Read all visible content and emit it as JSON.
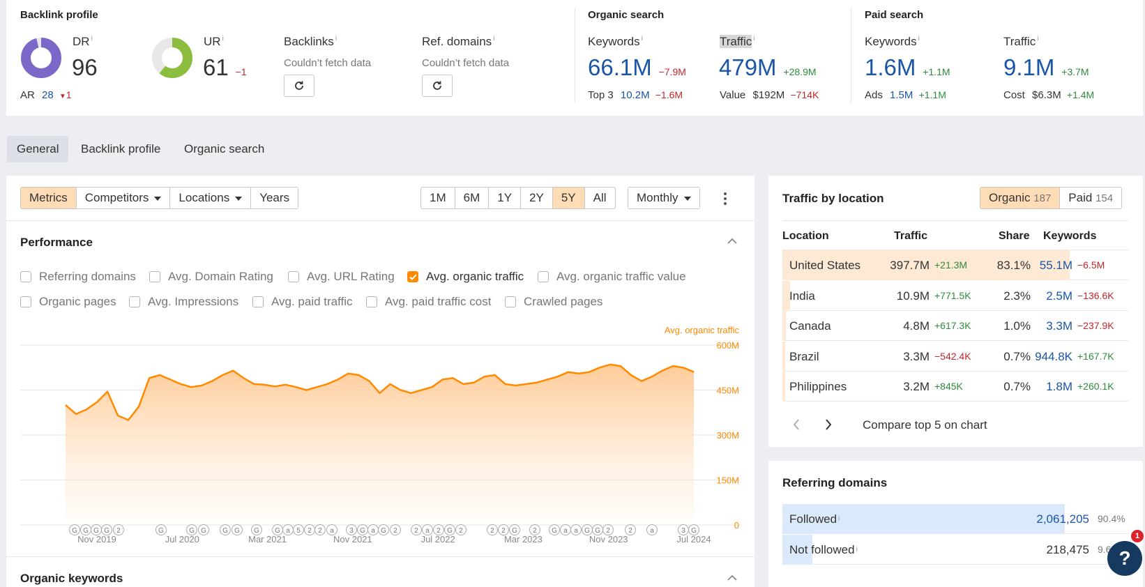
{
  "top": {
    "backlink": {
      "title": "Backlink profile",
      "dr_label": "DR",
      "dr_value": "96",
      "dr_fraction": 0.96,
      "ar_label": "AR",
      "ar_value": "28",
      "ar_delta": "1",
      "ur_label": "UR",
      "ur_value": "61",
      "ur_delta": "−1",
      "ur_fraction": 0.61,
      "backlinks_label": "Backlinks",
      "backlinks_status": "Couldn’t fetch data",
      "refdomains_label": "Ref. domains",
      "refdomains_status": "Couldn’t fetch data"
    },
    "organic": {
      "title": "Organic search",
      "keywords_label": "Keywords",
      "keywords_value": "66.1M",
      "keywords_delta": "−7.9M",
      "top3_label": "Top 3",
      "top3_value": "10.2M",
      "top3_delta": "−1.6M",
      "traffic_label": "Traffic",
      "traffic_value": "479M",
      "traffic_delta": "+28.9M",
      "value_label": "Value",
      "value_value": "$192M",
      "value_delta": "−714K"
    },
    "paid": {
      "title": "Paid search",
      "keywords_label": "Keywords",
      "keywords_value": "1.6M",
      "keywords_delta": "+1.1M",
      "ads_label": "Ads",
      "ads_value": "1.5M",
      "ads_delta": "+1.1M",
      "traffic_label": "Traffic",
      "traffic_value": "9.1M",
      "traffic_delta": "+3.7M",
      "cost_label": "Cost",
      "cost_value": "$6.3M",
      "cost_delta": "+1.4M"
    }
  },
  "tabs": [
    "General",
    "Backlink profile",
    "Organic search"
  ],
  "toolbar": {
    "modes": [
      "Metrics",
      "Competitors",
      "Locations",
      "Years"
    ],
    "ranges": [
      "1M",
      "6M",
      "1Y",
      "2Y",
      "5Y",
      "All"
    ],
    "interval": "Monthly"
  },
  "performance": {
    "title": "Performance",
    "checkboxes_row1": [
      "Referring domains",
      "Avg. Domain Rating",
      "Avg. URL Rating",
      "Avg. organic traffic",
      "Avg. organic traffic value"
    ],
    "checkboxes_row2": [
      "Organic pages",
      "Avg. Impressions",
      "Avg. paid traffic",
      "Avg. paid traffic cost",
      "Crawled pages"
    ],
    "checked": "Avg. organic traffic"
  },
  "chart_data": {
    "type": "area",
    "series": [
      {
        "name": "Avg. organic traffic",
        "values": [
          400,
          370,
          385,
          410,
          445,
          365,
          350,
          395,
          490,
          500,
          485,
          470,
          460,
          465,
          480,
          500,
          515,
          490,
          470,
          468,
          462,
          468,
          460,
          450,
          460,
          470,
          485,
          505,
          500,
          480,
          440,
          470,
          450,
          440,
          450,
          460,
          485,
          490,
          470,
          475,
          495,
          500,
          470,
          465,
          470,
          475,
          485,
          495,
          510,
          505,
          510,
          525,
          535,
          530,
          500,
          480,
          495,
          515,
          530,
          525,
          510
        ]
      }
    ],
    "x_tick_labels": [
      "Nov 2019",
      "Jul 2020",
      "Mar 2021",
      "Nov 2021",
      "Jul 2022",
      "Mar 2023",
      "Nov 2023",
      "Jul 2024"
    ],
    "y_tick_labels": [
      "600M",
      "450M",
      "300M",
      "150M",
      "0"
    ],
    "ylim": [
      0,
      600
    ],
    "ylabel": "Avg. organic traffic",
    "annotation_markers": [
      "G",
      "G",
      "G",
      "G",
      "2",
      "G",
      "G",
      "G",
      "G",
      "G",
      "G",
      "G",
      "a",
      "5",
      "2",
      "2",
      "a",
      "3",
      "G",
      "a",
      "G",
      "2",
      "2",
      "a",
      "2",
      "G",
      "2",
      "2",
      "2",
      "G",
      "2",
      "G",
      "a",
      "a",
      "G",
      "G",
      "2",
      "2",
      "a",
      "3",
      "G"
    ],
    "color": "#ff8a00"
  },
  "organic_keywords": {
    "title": "Organic keywords"
  },
  "traffic_by_location": {
    "title": "Traffic by location",
    "organic_label": "Organic",
    "organic_count": "187",
    "paid_label": "Paid",
    "paid_count": "154",
    "columns": [
      "Location",
      "Traffic",
      "Share",
      "Keywords"
    ],
    "rows": [
      {
        "location": "United States",
        "traffic": "397.7M",
        "traffic_delta": "+21.3M",
        "share": "83.1%",
        "share_fraction": 0.831,
        "keywords": "55.1M",
        "keywords_delta": "−6.5M"
      },
      {
        "location": "India",
        "traffic": "10.9M",
        "traffic_delta": "+771.5K",
        "share": "2.3%",
        "share_fraction": 0.023,
        "keywords": "2.5M",
        "keywords_delta": "−136.6K"
      },
      {
        "location": "Canada",
        "traffic": "4.8M",
        "traffic_delta": "+617.3K",
        "share": "1.0%",
        "share_fraction": 0.01,
        "keywords": "3.3M",
        "keywords_delta": "−237.9K"
      },
      {
        "location": "Brazil",
        "traffic": "3.3M",
        "traffic_delta": "−542.4K",
        "share": "0.7%",
        "share_fraction": 0.007,
        "keywords": "944.8K",
        "keywords_delta": "+167.7K"
      },
      {
        "location": "Philippines",
        "traffic": "3.2M",
        "traffic_delta": "+845K",
        "share": "0.7%",
        "share_fraction": 0.007,
        "keywords": "1.8M",
        "keywords_delta": "+260.1K"
      }
    ],
    "compare_label": "Compare top 5 on chart"
  },
  "referring_domains": {
    "title": "Referring domains",
    "rows": [
      {
        "label": "Followed",
        "value": "2,061,205",
        "pct": "90.4%",
        "fraction": 0.904
      },
      {
        "label": "Not followed",
        "value": "218,475",
        "pct": "9.6%",
        "fraction": 0.096
      }
    ]
  },
  "help": {
    "label": "?",
    "badge": "1"
  },
  "colors": {
    "accent": "#ff8a00",
    "dr_ring": "#7b68c8",
    "ur_ring": "#8cbd3f",
    "link_blue": "#1a55a6"
  }
}
